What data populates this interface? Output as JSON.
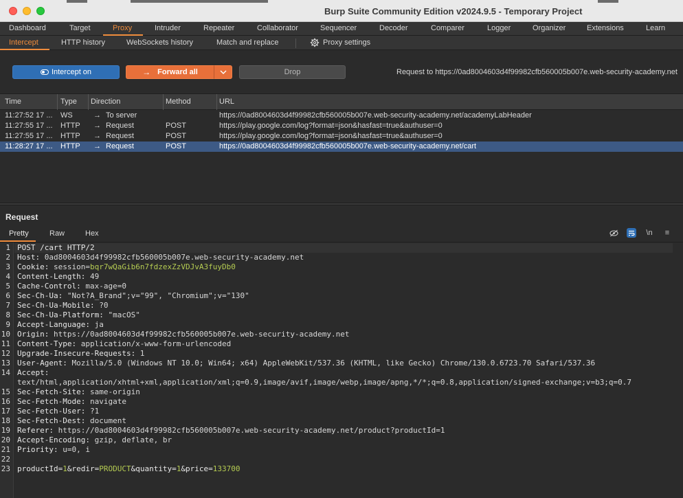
{
  "window": {
    "title": "Burp Suite Community Edition v2024.9.5 - Temporary Project"
  },
  "main_tabs": [
    {
      "label": "Dashboard",
      "active": false
    },
    {
      "label": "Target",
      "active": false
    },
    {
      "label": "Proxy",
      "active": true
    },
    {
      "label": "Intruder",
      "active": false
    },
    {
      "label": "Repeater",
      "active": false
    },
    {
      "label": "Collaborator",
      "active": false
    },
    {
      "label": "Sequencer",
      "active": false
    },
    {
      "label": "Decoder",
      "active": false
    },
    {
      "label": "Comparer",
      "active": false
    },
    {
      "label": "Logger",
      "active": false
    },
    {
      "label": "Organizer",
      "active": false
    },
    {
      "label": "Extensions",
      "active": false
    },
    {
      "label": "Learn",
      "active": false
    }
  ],
  "sub_tabs": [
    {
      "label": "Intercept",
      "active": true
    },
    {
      "label": "HTTP history",
      "active": false
    },
    {
      "label": "WebSockets history",
      "active": false
    },
    {
      "label": "Match and replace",
      "active": false
    },
    {
      "label": "Proxy settings",
      "active": false
    }
  ],
  "actions": {
    "intercept_label": "Intercept on",
    "forward_label": "Forward all",
    "drop_label": "Drop",
    "request_to": "Request to https://0ad8004603d4f99982cfb560005b007e.web-security-academy.net"
  },
  "table": {
    "headers": [
      "Time",
      "Type",
      "Direction",
      "Method",
      "URL"
    ],
    "rows": [
      {
        "time": "11:27:52 17 ...",
        "type": "WS",
        "direction": "To server",
        "method": "",
        "url": "https://0ad8004603d4f99982cfb560005b007e.web-security-academy.net/academyLabHeader",
        "selected": false
      },
      {
        "time": "11:27:55 17 ...",
        "type": "HTTP",
        "direction": "Request",
        "method": "POST",
        "url": "https://play.google.com/log?format=json&hasfast=true&authuser=0",
        "selected": false
      },
      {
        "time": "11:27:55 17 ...",
        "type": "HTTP",
        "direction": "Request",
        "method": "POST",
        "url": "https://play.google.com/log?format=json&hasfast=true&authuser=0",
        "selected": false
      },
      {
        "time": "11:28:27 17 ...",
        "type": "HTTP",
        "direction": "Request",
        "method": "POST",
        "url": "https://0ad8004603d4f99982cfb560005b007e.web-security-academy.net/cart",
        "selected": true
      }
    ]
  },
  "request_panel": {
    "title": "Request",
    "tabs": [
      {
        "label": "Pretty",
        "active": true
      },
      {
        "label": "Raw",
        "active": false
      },
      {
        "label": "Hex",
        "active": false
      }
    ],
    "newline_toggle": "\\n"
  },
  "request_lines": [
    {
      "n": "1",
      "key": "POST /cart HTTP/2",
      "val": "",
      "highlight": ""
    },
    {
      "n": "2",
      "key": "Host:",
      "val": " 0ad8004603d4f99982cfb560005b007e.web-security-academy.net",
      "highlight": ""
    },
    {
      "n": "3",
      "key": "Cookie:",
      "val": " session=",
      "highlight": "bqr7wQaGib6n7fdzexZzVDJvA3fuyDb0"
    },
    {
      "n": "4",
      "key": "Content-Length:",
      "val": " 49",
      "highlight": ""
    },
    {
      "n": "5",
      "key": "Cache-Control:",
      "val": " max-age=0",
      "highlight": ""
    },
    {
      "n": "6",
      "key": "Sec-Ch-Ua:",
      "val": " \"Not?A_Brand\";v=\"99\", \"Chromium\";v=\"130\"",
      "highlight": ""
    },
    {
      "n": "7",
      "key": "Sec-Ch-Ua-Mobile:",
      "val": " ?0",
      "highlight": ""
    },
    {
      "n": "8",
      "key": "Sec-Ch-Ua-Platform:",
      "val": " \"macOS\"",
      "highlight": ""
    },
    {
      "n": "9",
      "key": "Accept-Language:",
      "val": " ja",
      "highlight": ""
    },
    {
      "n": "10",
      "key": "Origin:",
      "val": " https://0ad8004603d4f99982cfb560005b007e.web-security-academy.net",
      "highlight": ""
    },
    {
      "n": "11",
      "key": "Content-Type:",
      "val": " application/x-www-form-urlencoded",
      "highlight": ""
    },
    {
      "n": "12",
      "key": "Upgrade-Insecure-Requests:",
      "val": " 1",
      "highlight": ""
    },
    {
      "n": "13",
      "key": "User-Agent:",
      "val": " Mozilla/5.0 (Windows NT 10.0; Win64; x64) AppleWebKit/537.36 (KHTML, like Gecko) Chrome/130.0.6723.70 Safari/537.36",
      "highlight": ""
    },
    {
      "n": "14",
      "key": "Accept:",
      "val": "",
      "highlight": ""
    },
    {
      "n": "",
      "key": "",
      "val": "text/html,application/xhtml+xml,application/xml;q=0.9,image/avif,image/webp,image/apng,*/*;q=0.8,application/signed-exchange;v=b3;q=0.7",
      "highlight": ""
    },
    {
      "n": "15",
      "key": "Sec-Fetch-Site:",
      "val": " same-origin",
      "highlight": ""
    },
    {
      "n": "16",
      "key": "Sec-Fetch-Mode:",
      "val": " navigate",
      "highlight": ""
    },
    {
      "n": "17",
      "key": "Sec-Fetch-User:",
      "val": " ?1",
      "highlight": ""
    },
    {
      "n": "18",
      "key": "Sec-Fetch-Dest:",
      "val": " document",
      "highlight": ""
    },
    {
      "n": "19",
      "key": "Referer:",
      "val": " https://0ad8004603d4f99982cfb560005b007e.web-security-academy.net/product?productId=1",
      "highlight": ""
    },
    {
      "n": "20",
      "key": "Accept-Encoding:",
      "val": " gzip, deflate, br",
      "highlight": ""
    },
    {
      "n": "21",
      "key": "Priority:",
      "val": " u=0, i",
      "highlight": ""
    },
    {
      "n": "22",
      "key": "",
      "val": "",
      "highlight": ""
    },
    {
      "n": "23",
      "key": "",
      "val": "",
      "highlight": "",
      "body": [
        {
          "t": "productId=",
          "c": "k"
        },
        {
          "t": "1",
          "c": "h"
        },
        {
          "t": "&redir=",
          "c": "k"
        },
        {
          "t": "PRODUCT",
          "c": "h"
        },
        {
          "t": "&quantity=",
          "c": "k"
        },
        {
          "t": "1",
          "c": "h"
        },
        {
          "t": "&price=",
          "c": "k"
        },
        {
          "t": "133700",
          "c": "h"
        }
      ]
    }
  ],
  "colors": {
    "accent": "#f08c3c",
    "intercept_blue": "#2f6fb5",
    "forward_orange": "#e8703a",
    "selected_row": "#3d5a85",
    "value_highlight": "#b5cc52"
  }
}
